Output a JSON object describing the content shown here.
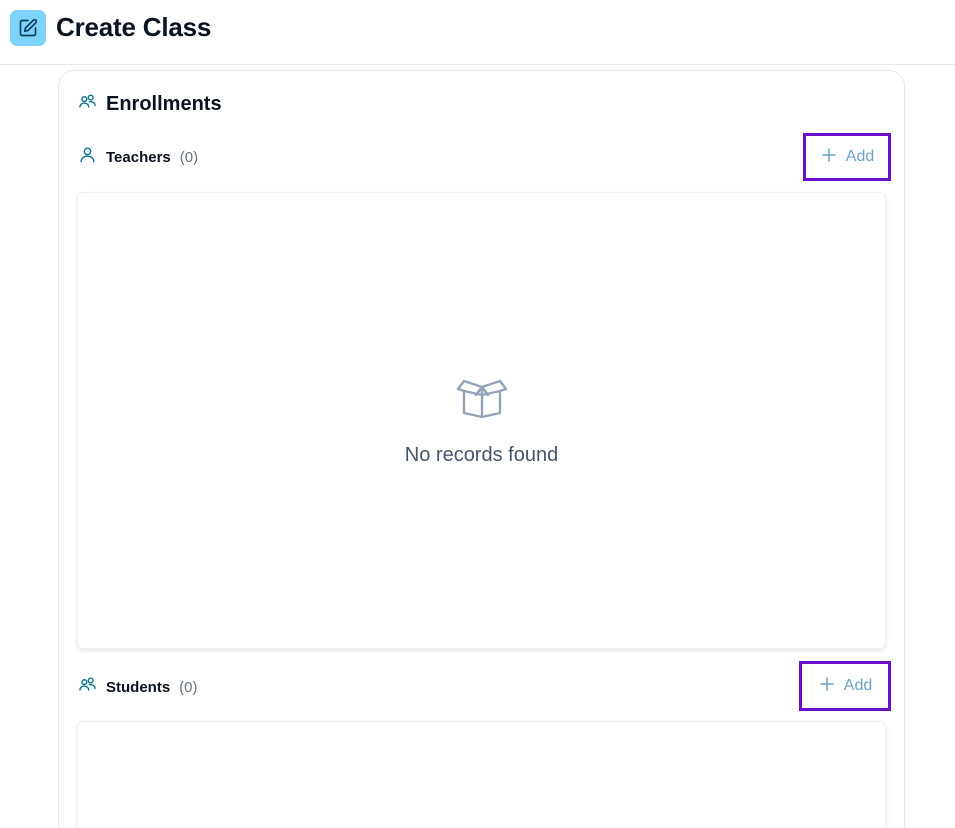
{
  "header": {
    "title": "Create Class",
    "icon": "edit-icon"
  },
  "enrollments": {
    "title": "Enrollments",
    "teachers": {
      "label": "Teachers",
      "count": "(0)",
      "add_label": "Add",
      "empty_text": "No records found"
    },
    "students": {
      "label": "Students",
      "count": "(0)",
      "add_label": "Add"
    }
  },
  "colors": {
    "accent": "#7dd3fc",
    "icon": "#0e7490",
    "highlight_border": "#6b10c9",
    "add_text": "#6aa2c6",
    "empty_icon": "#94a3b8"
  }
}
